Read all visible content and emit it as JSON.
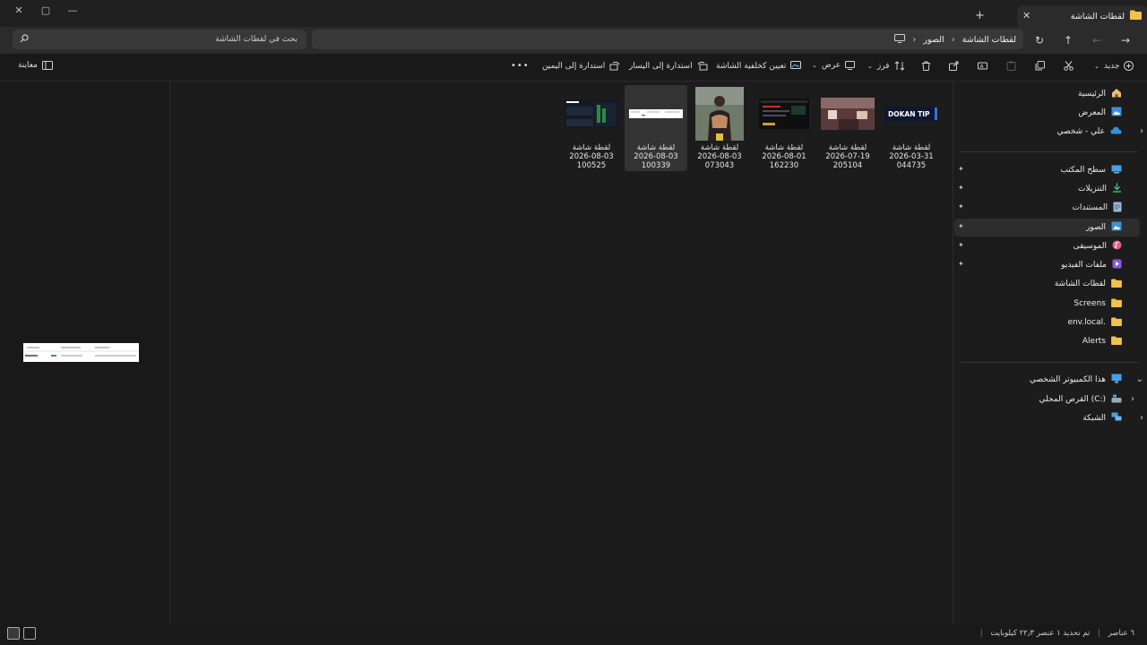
{
  "window": {
    "tab_title": "لقطات الشاشة",
    "controls": {
      "close": "✕",
      "maximize": "▢",
      "minimize": "—",
      "new_tab": "+",
      "tab_close": "✕"
    }
  },
  "address_bar": {
    "search_placeholder": "بحث في لقطات الشاشة",
    "breadcrumbs": [
      "الصور",
      "لقطات الشاشة"
    ],
    "nav": {
      "back": "←",
      "forward": "→",
      "up": "↑",
      "refresh": "↻"
    }
  },
  "command_bar": {
    "new_label": "جديد",
    "sort_label": "فرز",
    "view_label": "عرض",
    "set_wallpaper_label": "تعيين كخلفية الشاشة",
    "rotate_left_label": "استدارة إلى اليسار",
    "rotate_right_label": "استدارة إلى اليمين",
    "more_label": "•••",
    "preview_label": "معاينة"
  },
  "nav_pane": {
    "quick": [
      {
        "label": "الرئيسية",
        "icon": "home-icon"
      },
      {
        "label": "المعرض",
        "icon": "gallery-icon"
      },
      {
        "label": "علي - شخصي",
        "icon": "cloud-icon"
      }
    ],
    "pinned": [
      {
        "label": "سطح المكتب",
        "icon": "desktop-icon",
        "pinned": true
      },
      {
        "label": "التنزيلات",
        "icon": "download-icon",
        "pinned": true
      },
      {
        "label": "المستندات",
        "icon": "documents-icon",
        "pinned": true
      },
      {
        "label": "الصور",
        "icon": "pictures-icon",
        "pinned": true,
        "selected": true
      },
      {
        "label": "الموسيقى",
        "icon": "music-icon",
        "pinned": true
      },
      {
        "label": "ملفات الفيديو",
        "icon": "video-icon",
        "pinned": true
      },
      {
        "label": "لقطات الشاشة",
        "icon": "folder-icon",
        "pinned": false
      },
      {
        "label": "Screens",
        "icon": "folder-icon",
        "pinned": false
      },
      {
        "label": "env.local.",
        "icon": "folder-icon",
        "pinned": false
      },
      {
        "label": "Alerts",
        "icon": "folder-icon",
        "pinned": false
      }
    ],
    "system": [
      {
        "label": "هذا الكمبيوتر الشخصي",
        "icon": "pc-icon"
      },
      {
        "label": "القرص المحلي (C:)",
        "icon": "drive-icon"
      },
      {
        "label": "الشبكة",
        "icon": "network-icon"
      }
    ]
  },
  "files": [
    {
      "line1": "لقطة شاشة",
      "line2": "2026-03-31",
      "line3": "044735",
      "thumb": "dokan-tip",
      "thumb_text": "DOKAN TIP"
    },
    {
      "line1": "لقطة شاشة",
      "line2": "2026-07-19",
      "line3": "205104",
      "thumb": "room"
    },
    {
      "line1": "لقطة شاشة",
      "line2": "2026-08-01",
      "line3": "162230",
      "thumb": "dark-ui"
    },
    {
      "line1": "لقطة شاشة",
      "line2": "2026-08-03",
      "line3": "073043",
      "thumb": "person"
    },
    {
      "line1": "لقطة شاشة",
      "line2": "2026-08-03",
      "line3": "100339",
      "thumb": "white-strip",
      "selected": true
    },
    {
      "line1": "لقطة شاشة",
      "line2": "2026-08-03",
      "line3": "100525",
      "thumb": "dashboard"
    }
  ],
  "status_bar": {
    "item_count": "٦ عناصر",
    "selection": "تم تحديد ١ عنصر ٢٢٫٣ كيلوبايت"
  },
  "colors": {
    "accent_blue": "#3b8fd9",
    "folder_yellow": "#f2c24b",
    "background": "#1c1c1c"
  }
}
